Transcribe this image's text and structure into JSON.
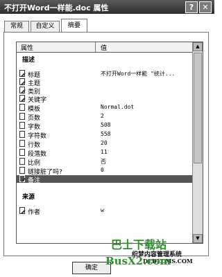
{
  "window": {
    "title": "不打开Word一样能.doc 属性",
    "help_icon": "?",
    "close_icon": "✕"
  },
  "tabs": [
    {
      "label": "常规",
      "active": false
    },
    {
      "label": "自定义",
      "active": false
    },
    {
      "label": "摘要",
      "active": true
    }
  ],
  "list": {
    "columns": {
      "name": "属性",
      "value": "值"
    },
    "groups": [
      {
        "label": "描述"
      },
      {
        "label": "来源"
      }
    ],
    "rows": [
      {
        "name": "标题",
        "value": "不打开Word一样能 \"统计...",
        "icon": "pencil-doc-icon"
      },
      {
        "name": "主题",
        "value": "",
        "icon": "pencil-doc-icon"
      },
      {
        "name": "类别",
        "value": "",
        "icon": "pencil-doc-icon"
      },
      {
        "name": "关键字",
        "value": "",
        "icon": "pencil-doc-icon"
      },
      {
        "name": "模板",
        "value": "Normal.dot",
        "icon": "doc-icon"
      },
      {
        "name": "页数",
        "value": "2",
        "icon": "doc-icon"
      },
      {
        "name": "字数",
        "value": "508",
        "icon": "doc-icon"
      },
      {
        "name": "字符数",
        "value": "558",
        "icon": "doc-icon"
      },
      {
        "name": "行数",
        "value": "20",
        "icon": "doc-icon"
      },
      {
        "name": "段落数",
        "value": "11",
        "icon": "doc-icon"
      },
      {
        "name": "比例",
        "value": "否",
        "icon": "doc-icon"
      },
      {
        "name": "链接脏了吗?",
        "value": "0",
        "icon": "doc-icon"
      },
      {
        "name": "备注",
        "value": "",
        "icon": "pencil-doc-icon",
        "selected": true
      },
      {
        "name": "作者",
        "value": "w",
        "icon": "pencil-doc-icon"
      }
    ]
  },
  "buttons": {
    "ok": "确定"
  },
  "watermark": {
    "line1": "巴士下载站",
    "line2": "织梦内容管理系统",
    "line3": "DEDECMS.COM",
    "line4": "BusX2.com"
  },
  "colors": {
    "titlebar": "#3a3a3a",
    "selected_row": "#555555"
  }
}
